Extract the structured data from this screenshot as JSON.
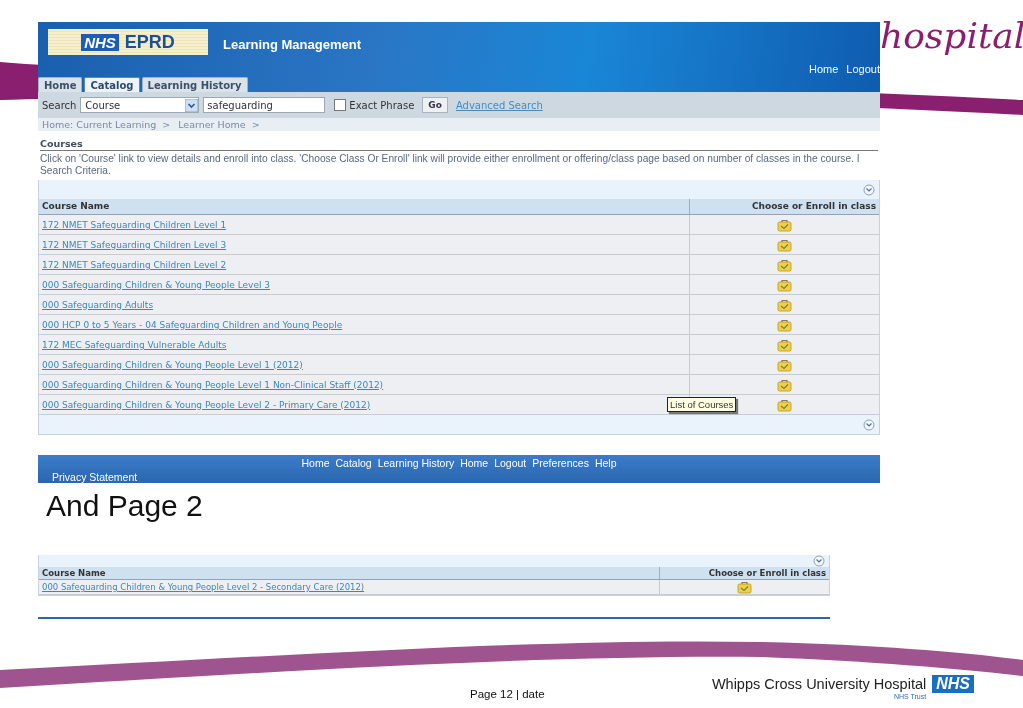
{
  "slide": {
    "brand_script": "hospital",
    "heading": "And Page 2",
    "page": "Page 12 | date",
    "org": "Whipps Cross University Hospital",
    "org_badge": "NHS",
    "org_sub": "NHS Trust"
  },
  "screen1": {
    "brand": {
      "badge": "NHS",
      "name": "EPRD",
      "title": "Learning Management"
    },
    "global_links": [
      "Home",
      "Logout"
    ],
    "tabs": [
      {
        "label": "Home",
        "selected": false
      },
      {
        "label": "Catalog",
        "selected": true
      },
      {
        "label": "Learning History",
        "selected": false
      }
    ],
    "search": {
      "label": "Search",
      "type": "Course",
      "query": "safeguarding",
      "exact_label": "Exact Phrase",
      "exact_checked": false,
      "go": "Go",
      "advanced": "Advanced Search"
    },
    "breadcrumbs": [
      "Home: Current Learning  >",
      "Learner Home  >"
    ],
    "section": "Courses",
    "instructions": [
      "Click on 'Course' link to view details and enroll into class. 'Choose Class Or Enroll' link will provide either enrollment or offering/class page based on number of classes in the course. I",
      "Search Criteria."
    ],
    "table": {
      "columns": [
        "Course Name",
        "Choose or Enroll in class"
      ],
      "rows": [
        {
          "course": "172 NMET Safeguarding Children Level 1"
        },
        {
          "course": "172 NMET Safeguarding Children Level 3"
        },
        {
          "course": "172 NMET Safeguarding Children Level 2"
        },
        {
          "course": "000 Safeguarding Children & Young People Level 3"
        },
        {
          "course": "000 Safeguarding Adults"
        },
        {
          "course": "000 HCP 0 to 5 Years - 04 Safeguarding Children and Young People"
        },
        {
          "course": "172 MEC Safeguarding Vulnerable Adults"
        },
        {
          "course": "000 Safeguarding Children & Young People Level 1 (2012)"
        },
        {
          "course": "000 Safeguarding Children & Young People Level 1 Non-Clinical Staff (2012)"
        },
        {
          "course": "000 Safeguarding Children & Young People Level 2 - Primary Care (2012)"
        }
      ]
    },
    "tooltip": "List of Courses",
    "footer_links": [
      "Home",
      "Catalog",
      "Learning History",
      "Home",
      "Logout",
      "Preferences",
      "Help"
    ],
    "privacy": "Privacy Statement"
  },
  "screen2": {
    "table": {
      "columns": [
        "Course Name",
        "Choose or Enroll in class"
      ],
      "rows": [
        {
          "course": "000 Safeguarding Children & Young People Level 2 - Secondary Care (2012)"
        }
      ]
    }
  }
}
